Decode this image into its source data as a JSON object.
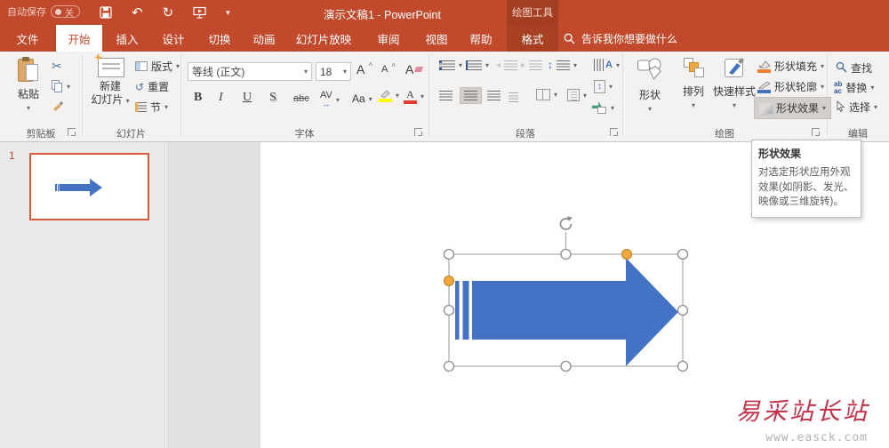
{
  "titlebar": {
    "autosave_label": "自动保存",
    "autosave_state": "关",
    "title": "演示文稿1 - PowerPoint",
    "context_tool_label": "绘图工具"
  },
  "tabs": [
    {
      "label": "文件"
    },
    {
      "label": "开始"
    },
    {
      "label": "插入"
    },
    {
      "label": "设计"
    },
    {
      "label": "切换"
    },
    {
      "label": "动画"
    },
    {
      "label": "幻灯片放映"
    },
    {
      "label": "审阅"
    },
    {
      "label": "视图"
    },
    {
      "label": "帮助"
    },
    {
      "label": "格式"
    }
  ],
  "search": {
    "placeholder": "告诉我你想要做什么"
  },
  "ribbon": {
    "clipboard": {
      "label": "剪贴板",
      "paste": "粘贴"
    },
    "slides": {
      "label": "幻灯片",
      "new_slide_line1": "新建",
      "new_slide_line2": "幻灯片",
      "layout": "版式",
      "reset": "重置",
      "section": "节"
    },
    "font": {
      "label": "字体",
      "name": "等线 (正文)",
      "size": "18",
      "bold": "B",
      "italic": "I",
      "underline": "U",
      "shadow": "S",
      "strike": "abc",
      "spacing": "AV",
      "case": "Aa",
      "grow": "A",
      "shrink": "A",
      "clear": "A"
    },
    "paragraph": {
      "label": "段落",
      "textdir_letter": "A"
    },
    "drawing": {
      "label": "绘图",
      "shapes": "形状",
      "arrange": "排列",
      "quick_styles": "快速样式",
      "shape_fill": "形状填充",
      "shape_outline": "形状轮廓",
      "shape_effects": "形状效果"
    },
    "editing": {
      "label": "编辑",
      "find": "查找",
      "replace": "替换",
      "select": "选择",
      "replace_icon_top": "ab",
      "replace_icon_bottom": "ac"
    }
  },
  "tooltip": {
    "title": "形状效果",
    "body": "对选定形状应用外观效果(如阴影、发光、映像或三维旋转)。"
  },
  "slides_panel": {
    "slide_number": "1"
  },
  "watermark": {
    "title": "易采站长站",
    "url": "www.easck.com"
  },
  "icons": {
    "undo": "↶",
    "redo": "↻",
    "dropdown": "▾",
    "scissors": "✂",
    "updown_arrow": "↕"
  },
  "colors": {
    "titlebar_red": "#c1492c",
    "context_red": "#a33e22",
    "accent_blue": "#4472c4",
    "selection_orange": "#f0a73e",
    "thumbnail_border": "#d9593d",
    "fill_swatch_orange": "#ed7d31",
    "outline_swatch_blue": "#4472c4",
    "highlight_yellow": "#ffff00",
    "font_color_red": "#e03c31"
  }
}
